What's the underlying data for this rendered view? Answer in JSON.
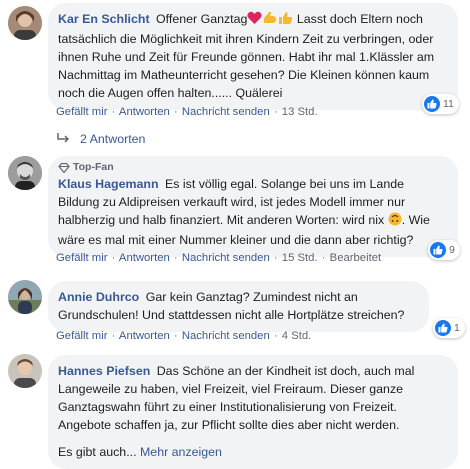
{
  "comments": [
    {
      "name": "Kar En Schlicht",
      "text_a": "Offener Ganztag",
      "text_b": "Lasst doch Eltern noch tatsächlich die Möglichkeit mit ihren Kindern Zeit zu verbringen, oder ihnen Ruhe und Zeit für Freunde gönnen. Habt ihr mal 1.Klässler am Nachmittag im Matheunterricht gesehen? Die Kleinen können kaum noch die Augen offen halten...... Quälerei",
      "emoji_after_a": [
        "heart-emoji",
        "muscle-emoji",
        "thumbs-up-emoji"
      ],
      "actions": [
        "Gefällt mir",
        "Antworten",
        "Nachricht senden",
        "13 Std."
      ],
      "reaction_count": "11",
      "replies_label": "2 Antworten"
    },
    {
      "badge": "Top-Fan",
      "name": "Klaus Hagemann",
      "text_a": "Es ist völlig egal. Solange bei uns im Lande Bildung zu Aldipreisen verkauft wird, ist jedes Modell immer nur halbherzig und halb finanziert. Mit anderen Worten: wird nix",
      "text_b": ". Wie wäre es mal mit einer Nummer kleiner und die dann aber richtig?",
      "emoji": "upside-down-face-emoji",
      "actions": [
        "Gefällt mir",
        "Antworten",
        "Nachricht senden",
        "15 Std.",
        "Bearbeitet"
      ],
      "reaction_count": "9"
    },
    {
      "name": "Annie Duhrco",
      "text_a": "Gar kein Ganztag? Zumindest nicht an Grundschulen! Und stattdessen nicht alle Hortplätze streichen?",
      "actions": [
        "Gefällt mir",
        "Antworten",
        "Nachricht senden",
        "4 Std."
      ],
      "reaction_count": "1"
    },
    {
      "name": "Hannes Piefsen",
      "text_a": "Das Schöne an der Kindheit ist doch, auch mal Langeweile zu haben, viel Freizeit, viel Freiraum. Dieser ganze Ganztagswahn führt zu einer Institutionalisierung von Freizeit. Angebote schaffen ja, zur Pflicht sollte dies aber nicht werden.",
      "text_c": "Es gibt auch...",
      "more_label": "Mehr anzeigen"
    }
  ],
  "colors": {
    "link": "#385898",
    "bubble": "#f2f3f5",
    "meta": "#606770",
    "like": "#1877f2"
  }
}
